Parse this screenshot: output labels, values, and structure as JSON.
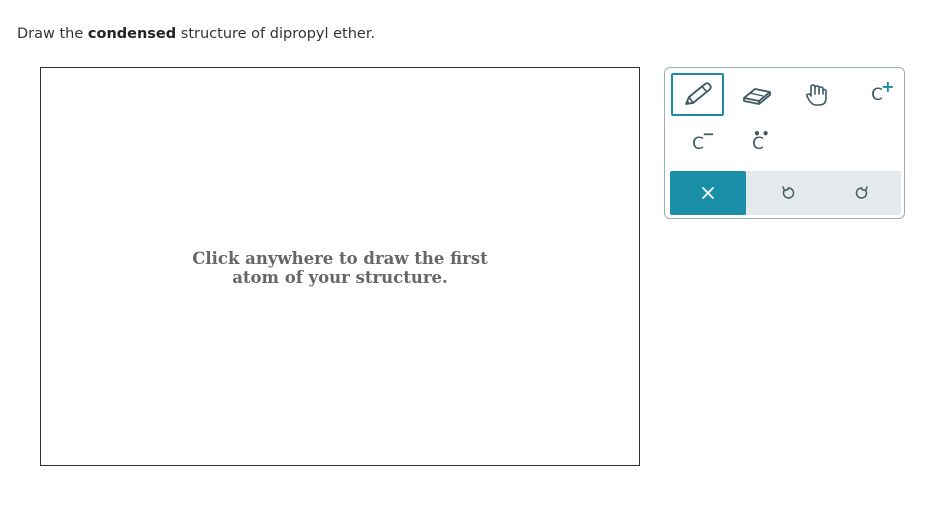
{
  "question": {
    "prefix": "Draw the ",
    "emphasis": "condensed",
    "suffix": " structure of dipropyl ether."
  },
  "canvas": {
    "hint_line1": "Click anywhere to draw the first",
    "hint_line2": "atom of your structure."
  },
  "toolbar": {
    "cplus_symbol": "C",
    "cplus_charge": "+",
    "cminus_symbol": "C",
    "cminus_charge": "−",
    "lonepair_symbol": "C",
    "lonepair_dots": "••",
    "icons": [
      "pencil-icon",
      "eraser-icon",
      "hand-icon",
      "close-icon",
      "undo-icon",
      "redo-icon"
    ],
    "colors": {
      "accent": "#1a8ea6",
      "bar": "#e4e9ec",
      "icon": "#3e5a62"
    }
  }
}
